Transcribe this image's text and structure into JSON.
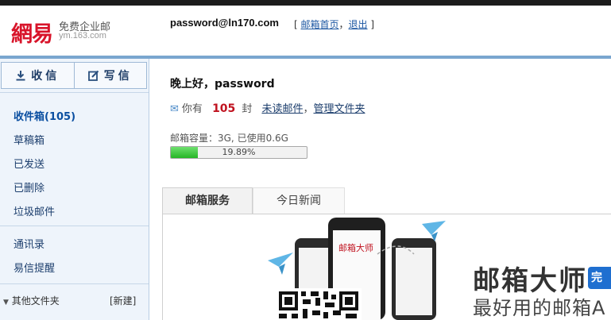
{
  "header": {
    "logo_mark": "網易",
    "logo_title": "免费企业邮",
    "logo_domain": "ym.163.com",
    "user_email": "password@ln170.com",
    "link_home": "邮箱首页",
    "link_logout": "退出",
    "bracket_open": "[",
    "separator": "，",
    "bracket_close": "]"
  },
  "sidebar": {
    "receive_label": "收信",
    "compose_label": "写信",
    "folders": [
      {
        "label": "收件箱(105)"
      },
      {
        "label": "草稿箱"
      },
      {
        "label": "已发送"
      },
      {
        "label": "已删除"
      },
      {
        "label": "垃圾邮件"
      }
    ],
    "contacts": "通讯录",
    "reminder": "易信提醒",
    "other_folders": "其他文件夹",
    "new_folder": "[新建]"
  },
  "main": {
    "greeting": "晚上好，password",
    "you_have": "你有",
    "unread_count": "105",
    "unit": "封",
    "unread_link": "未读邮件",
    "comma": "，",
    "manage_link": "管理文件夹",
    "quota_label": "邮箱容量：3G, 已使用0.6G",
    "quota_percent_text": "19.89%",
    "quota_fraction": 0.1989,
    "tabs": [
      {
        "label": "邮箱服务"
      },
      {
        "label": "今日新闻"
      }
    ],
    "promo_title": "邮箱大师",
    "promo_badge": "完",
    "promo_subtitle": "最好用的邮箱A"
  },
  "colors": {
    "brand_red": "#d8142a",
    "link_blue": "#1c57a2",
    "quota_green": "#26b526",
    "count_red": "#c0121f"
  },
  "icons": {
    "receive": "download-icon",
    "compose": "compose-icon",
    "mail": "envelope-icon",
    "qr": "qr-code-icon",
    "phone": "phone-illustration-icon",
    "plane": "paper-plane-icon"
  }
}
